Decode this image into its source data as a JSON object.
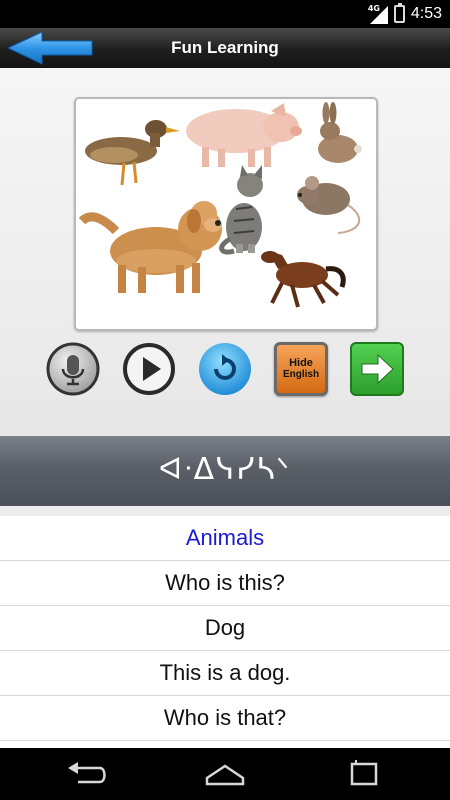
{
  "status_bar": {
    "network": "4G",
    "time": "4:53"
  },
  "title_bar": {
    "title": "Fun Learning"
  },
  "image": {
    "animals": [
      "duck-icon",
      "pig-icon",
      "rabbit-icon",
      "dog-icon",
      "cat-icon",
      "mouse-icon",
      "horse-icon"
    ]
  },
  "buttons": {
    "hide_line1": "Hide",
    "hide_line2": "English"
  },
  "syllabics": {
    "text": "ᐊᐧᐃᓭᓯᓴᐠ"
  },
  "phrases": {
    "header": "Animals",
    "items": [
      "Who is this?",
      "Dog",
      "This is a dog.",
      "Who is that?"
    ]
  },
  "colors": {
    "header_text": "#1a1ad6",
    "next_button": "#3cb83c",
    "hide_button": "#e8822a",
    "replay_button": "#2a9fe0"
  }
}
